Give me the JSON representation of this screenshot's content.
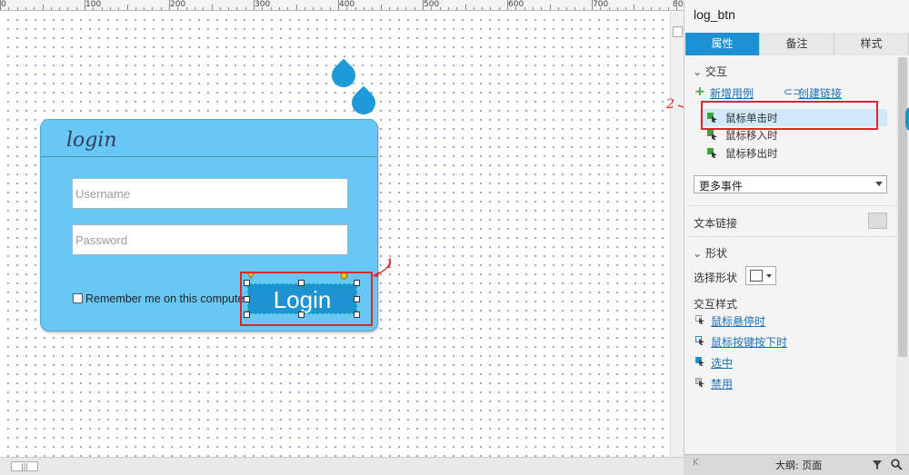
{
  "ruler": {
    "labels": [
      "0",
      "100",
      "200",
      "300",
      "400",
      "500",
      "600",
      "700",
      "80"
    ]
  },
  "canvas": {
    "login_title": "login",
    "username_placeholder": "Username",
    "password_placeholder": "Password",
    "remember_label": "Remember me on this computer",
    "login_button": "Login",
    "annotation_1": "1",
    "annotation_2": "2"
  },
  "panel": {
    "title": "log_btn",
    "tabs": [
      "属性",
      "备注",
      "样式"
    ],
    "interaction_section": "交互",
    "add_case": "新增用例",
    "create_link": "创建链接",
    "events": [
      "鼠标单击时",
      "鼠标移入时",
      "鼠标移出时"
    ],
    "more_events": "更多事件",
    "text_link": "文本链接",
    "shape_section": "形状",
    "select_shape": "选择形状",
    "interaction_styles": "交互样式",
    "style_links": [
      "鼠标悬停时",
      "鼠标按键按下时",
      "选中",
      "禁用"
    ],
    "status_text": "大纲: 页面"
  },
  "colors": {
    "accent": "#1d92d3",
    "card": "#69c7f6",
    "highlight": "#e0252b"
  }
}
